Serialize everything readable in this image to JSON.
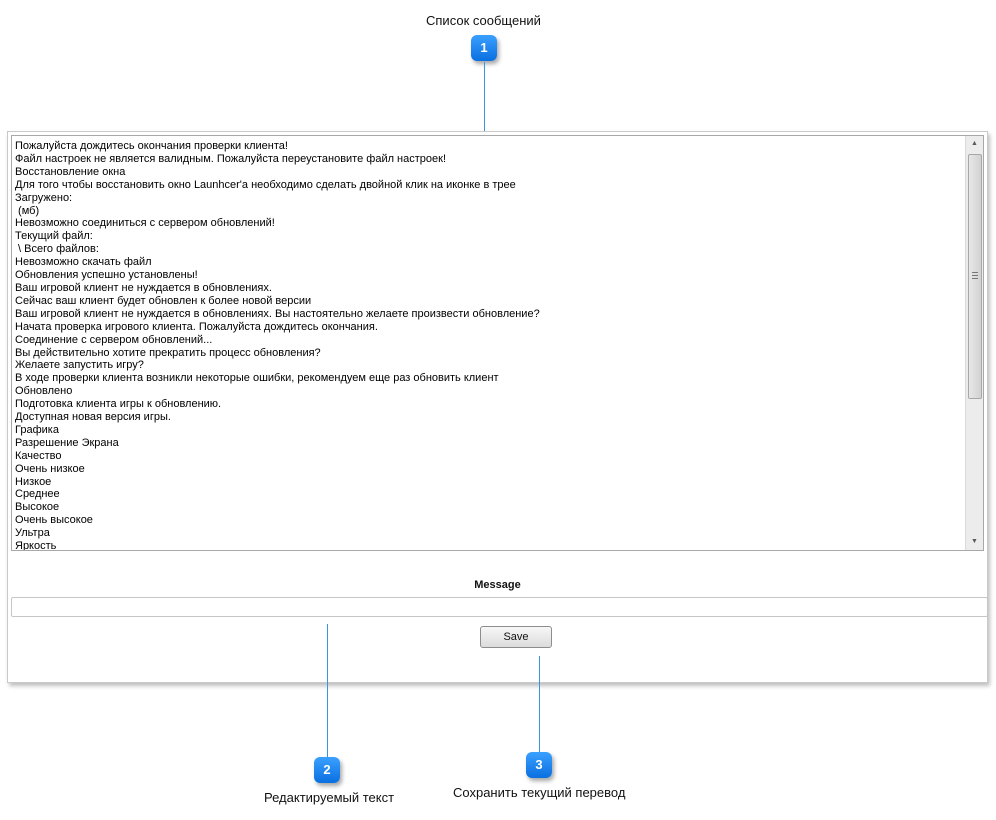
{
  "callouts": [
    {
      "number": "1",
      "label": "Список сообщений"
    },
    {
      "number": "2",
      "label": "Редактируемый текст"
    },
    {
      "number": "3",
      "label": "Сохранить текущий перевод"
    }
  ],
  "messages": [
    "Пожалуйста дождитесь окончания проверки клиента!",
    "Файл настроек не является валидным. Пожалуйста переустановите файл настроек!",
    "Восстановление окна",
    "Для того чтобы восстановить окно Launhcer'a необходимо сделать двойной клик на иконке в трее",
    "Загружено:",
    " (мб)",
    "Невозможно соединиться с сервером обновлений!",
    "Текущий файл:",
    " \\ Всего файлов:",
    "Невозможно скачать файл",
    "Обновления успешно установлены!",
    "Ваш игровой клиент не нуждается в обновлениях.",
    "Сейчас ваш клиент будет обновлен к более новой версии",
    "Ваш игровой клиент не нуждается в обновлениях. Вы настоятельно желаете произвести обновление?",
    "Начата проверка игрового клиента. Пожалуйста дождитесь окончания.",
    "Соединение с сервером обновлений...",
    "Вы действительно хотите прекратить процесс обновления?",
    "Желаете запустить игру?",
    "В ходе проверки клиента возникли некоторые ошибки, рекомендуем еще раз обновить клиент",
    "Обновлено",
    "Подготовка клиента игры к обновлению.",
    "Доступная новая версия игры.",
    "Графика",
    "Разрешение Экрана",
    "Качество",
    "Очень низкое",
    "Низкое",
    "Среднее",
    "Высокое",
    "Очень высокое",
    "Ультра",
    "Яркость"
  ],
  "message_label": "Message",
  "message_value": "",
  "save_label": "Save",
  "scrollbar": {
    "up_arrow": "▲",
    "down_arrow": "▼"
  }
}
